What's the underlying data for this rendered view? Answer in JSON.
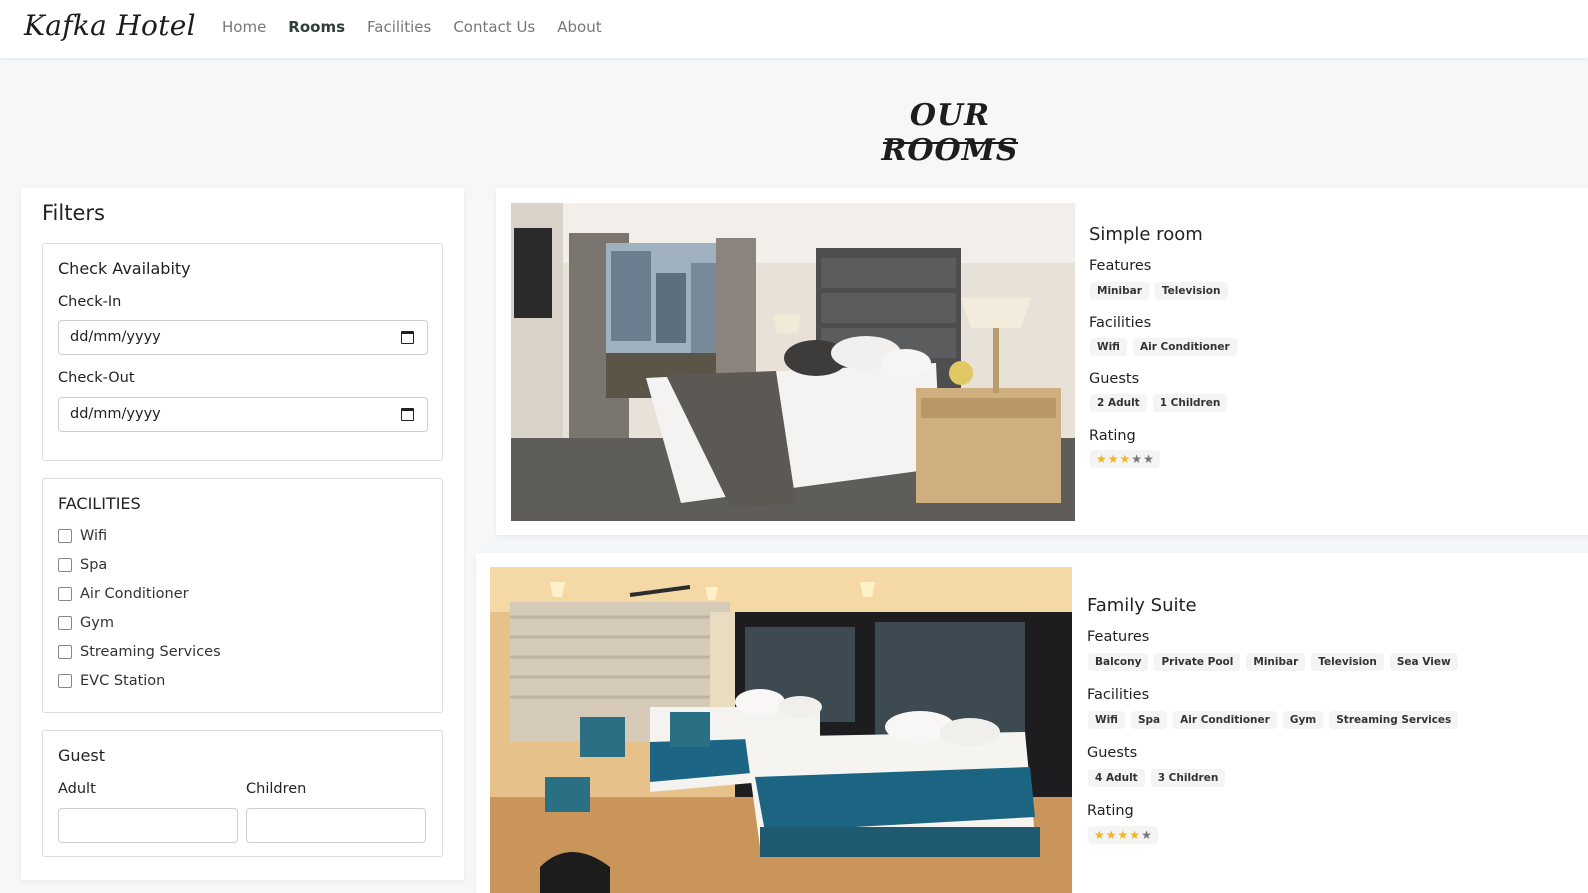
{
  "brand": "Kafka Hotel",
  "nav": [
    "Home",
    "Rooms",
    "Facilities",
    "Contact Us",
    "About"
  ],
  "nav_active": "Rooms",
  "page_title": "OUR ROOMS",
  "filters": {
    "title": "Filters",
    "availability": {
      "title": "Check Availabity",
      "checkin_label": "Check-In",
      "checkin_value": "dd/mm/yyyy",
      "checkout_label": "Check-Out",
      "checkout_value": "dd/mm/yyyy"
    },
    "facilities": {
      "title": "FACILITIES",
      "options": [
        "Wifi",
        "Spa",
        "Air Conditioner",
        "Gym",
        "Streaming Services",
        "EVC Station"
      ]
    },
    "guest": {
      "title": "Guest",
      "adult_label": "Adult",
      "children_label": "Children",
      "adult_value": "",
      "children_value": ""
    }
  },
  "rooms": [
    {
      "name": "Simple room",
      "features_label": "Features",
      "features": [
        "Minibar",
        "Television"
      ],
      "facilities_label": "Facilities",
      "facilities": [
        "Wifi",
        "Air Conditioner"
      ],
      "guests_label": "Guests",
      "guests": [
        "2 Adult",
        "1 Children"
      ],
      "rating_label": "Rating",
      "rating": 3,
      "rating_max": 5
    },
    {
      "name": "Family Suite",
      "features_label": "Features",
      "features": [
        "Balcony",
        "Private Pool",
        "Minibar",
        "Television",
        "Sea View"
      ],
      "facilities_label": "Facilities",
      "facilities": [
        "Wifi",
        "Spa",
        "Air Conditioner",
        "Gym",
        "Streaming Services"
      ],
      "guests_label": "Guests",
      "guests": [
        "4 Adult",
        "3 Children"
      ],
      "rating_label": "Rating",
      "rating": 4,
      "rating_max": 5
    }
  ],
  "icons": {
    "calendar": "calendar-icon",
    "star": "star-icon"
  },
  "colors": {
    "star_on": "#f0b429",
    "star_off": "#777777",
    "nav_active": "#2f3e36"
  }
}
